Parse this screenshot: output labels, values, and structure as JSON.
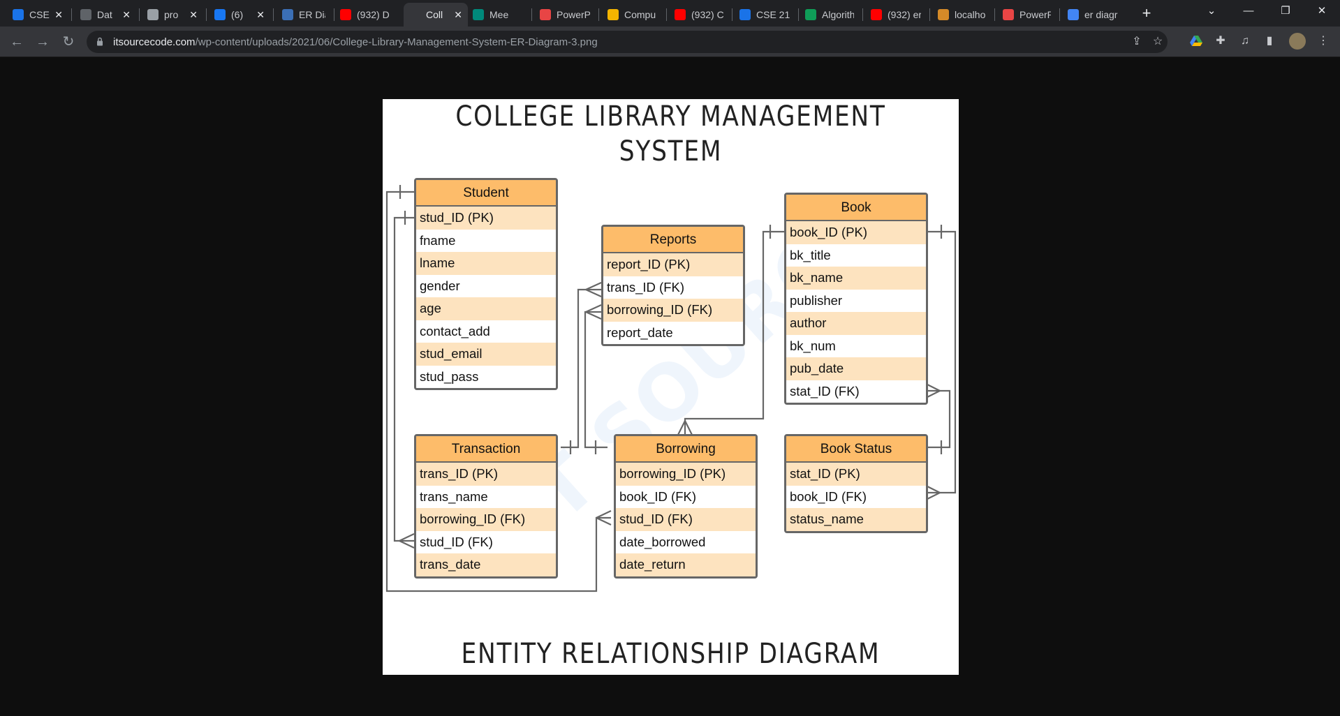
{
  "browser": {
    "tabs": [
      {
        "title": "CSE",
        "closable": true,
        "color": "#1a73e8"
      },
      {
        "title": "Dat",
        "closable": true,
        "color": "#5f6368"
      },
      {
        "title": "pro",
        "closable": true,
        "color": "#9aa0a6"
      },
      {
        "title": "(6)",
        "closable": true,
        "color": "#1877f2"
      },
      {
        "title": "ER Diag",
        "closable": false,
        "color": "#3b6fb6"
      },
      {
        "title": "(932) D",
        "closable": false,
        "color": "#ff0000"
      },
      {
        "title": "Coll",
        "closable": true,
        "color": "#35363a",
        "active": true
      },
      {
        "title": "Mee",
        "closable": false,
        "color": "#00897b"
      },
      {
        "title": "PowerP",
        "closable": false,
        "color": "#e84545"
      },
      {
        "title": "Compu",
        "closable": false,
        "color": "#f4b400"
      },
      {
        "title": "(932) C",
        "closable": false,
        "color": "#ff0000"
      },
      {
        "title": "CSE 21",
        "closable": false,
        "color": "#1a73e8"
      },
      {
        "title": "Algorith",
        "closable": false,
        "color": "#0f9d58"
      },
      {
        "title": "(932) er",
        "closable": false,
        "color": "#ff0000"
      },
      {
        "title": "localho",
        "closable": false,
        "color": "#d58a28"
      },
      {
        "title": "PowerP",
        "closable": false,
        "color": "#e84545"
      },
      {
        "title": "er diagr",
        "closable": false,
        "color": "#4285f4"
      }
    ],
    "url_host": "itsourcecode.com",
    "url_path": "/wp-content/uploads/2021/06/College-Library-Management-System-ER-Diagram-3.png"
  },
  "diagram": {
    "title": "COLLEGE LIBRARY MANAGEMENT SYSTEM",
    "subtitle": "ENTITY RELATIONSHIP DIAGRAM",
    "entities": {
      "student": {
        "name": "Student",
        "attributes": [
          "stud_ID (PK)",
          "fname",
          "lname",
          "gender",
          "age",
          "contact_add",
          "stud_email",
          "stud_pass"
        ]
      },
      "reports": {
        "name": "Reports",
        "attributes": [
          "report_ID (PK)",
          "trans_ID (FK)",
          "borrowing_ID (FK)",
          "report_date"
        ]
      },
      "book": {
        "name": "Book",
        "attributes": [
          "book_ID (PK)",
          "bk_title",
          "bk_name",
          "publisher",
          "author",
          "bk_num",
          "pub_date",
          "stat_ID (FK)"
        ]
      },
      "transaction": {
        "name": "Transaction",
        "attributes": [
          "trans_ID (PK)",
          "trans_name",
          "borrowing_ID (FK)",
          "stud_ID (FK)",
          "trans_date"
        ]
      },
      "borrowing": {
        "name": "Borrowing",
        "attributes": [
          "borrowing_ID (PK)",
          "book_ID (FK)",
          "stud_ID (FK)",
          "date_borrowed",
          "date_return"
        ]
      },
      "book_status": {
        "name": "Book Status",
        "attributes": [
          "stat_ID (PK)",
          "book_ID (FK)",
          "status_name"
        ]
      }
    }
  }
}
